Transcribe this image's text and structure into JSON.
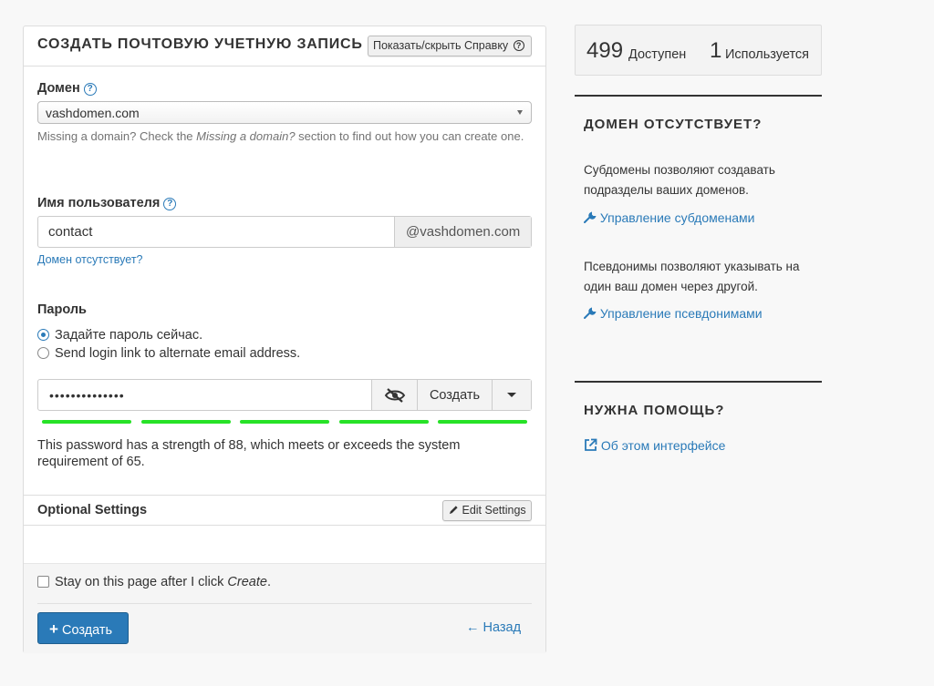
{
  "form": {
    "title": "СОЗДАТЬ ПОЧТОВУЮ УЧЕТНУЮ ЗАПИСЬ",
    "help_toggle": "Показать/скрыть Справку",
    "domain": {
      "label": "Домен",
      "value": "vashdomen.com",
      "help_prefix": "Missing a domain? Check the ",
      "help_italic": "Missing a domain?",
      "help_suffix": " section to find out how you can create one."
    },
    "username": {
      "label": "Имя пользователя",
      "value": "contact",
      "suffix": "@vashdomen.com",
      "missing_link": "Домен отсутствует?"
    },
    "password": {
      "label": "Пароль",
      "option_set_now": "Задайте пароль сейчас.",
      "option_send_link": "Send login link to alternate email address.",
      "selected_option": "set_now",
      "masked_value": "••••••••••••••",
      "generate_label": "Создать",
      "strength_value": 88,
      "strength_required": 65,
      "strength_color": "#27e227",
      "strength_text": "This password has a strength of 88, which meets or exceeds the system requirement of 65."
    },
    "optional": {
      "title": "Optional Settings",
      "edit_label": "Edit Settings"
    },
    "footer": {
      "stay_prefix": "Stay on this page after I click ",
      "stay_italic": "Create",
      "stay_suffix": ".",
      "stay_checked": false,
      "create_label": "Создать",
      "back_label": "Назад"
    }
  },
  "sidebar": {
    "stats": {
      "available_count": "499",
      "available_label": "Доступен",
      "used_count": "1",
      "used_label": "Используется"
    },
    "missing_domain": {
      "heading": "ДОМЕН ОТСУТСТВУЕТ?",
      "subdomains_text": "Субдомены позволяют создавать подразделы ваших доменов.",
      "subdomains_link": "Управление субдоменами",
      "aliases_text": "Псевдонимы позволяют указывать на один ваш домен через другой.",
      "aliases_link": "Управление псевдонимами"
    },
    "help": {
      "heading": "НУЖНА ПОМОЩЬ?",
      "link": "Об этом интерфейсе"
    }
  },
  "colors": {
    "accent": "#2a7ab8",
    "strength_bar": "#27e227"
  }
}
